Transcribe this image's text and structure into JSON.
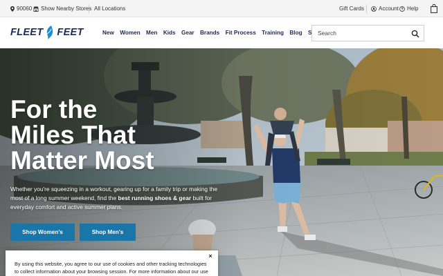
{
  "utility_bar": {
    "zip": "90060",
    "nearby_stores": "Show Nearby Stores",
    "all_locations": "All Locations",
    "gift_cards": "Gift Cards",
    "account": "Account",
    "help": "Help"
  },
  "header": {
    "logo_left": "FLEET",
    "logo_right": "FEET",
    "nav": [
      "New",
      "Women",
      "Men",
      "Kids",
      "Gear",
      "Brands",
      "Fit Process",
      "Training",
      "Blog",
      "Sale"
    ],
    "search_placeholder": "Search"
  },
  "hero": {
    "title_lines": [
      "For the",
      "Miles That",
      "Matter Most"
    ],
    "copy_before": "Whether you're squeezing in a workout, gearing up for a family trip or making the most of a long summer weekend, find the ",
    "copy_bold": "best running shoes & gear",
    "copy_after": " built for everyday comfort and active summer plans.",
    "button_women": "Shop Women's",
    "button_men": "Shop Men's"
  },
  "cookie_banner": {
    "text": "By using this website, you agree to our use of cookies and other tracking technologies to collect information about your browsing session. For more information about our use of",
    "close": "×"
  },
  "colors": {
    "brand_navy": "#1b2a56",
    "logo_accent": "#1a8fd6",
    "button_blue": "#1a75a8"
  }
}
